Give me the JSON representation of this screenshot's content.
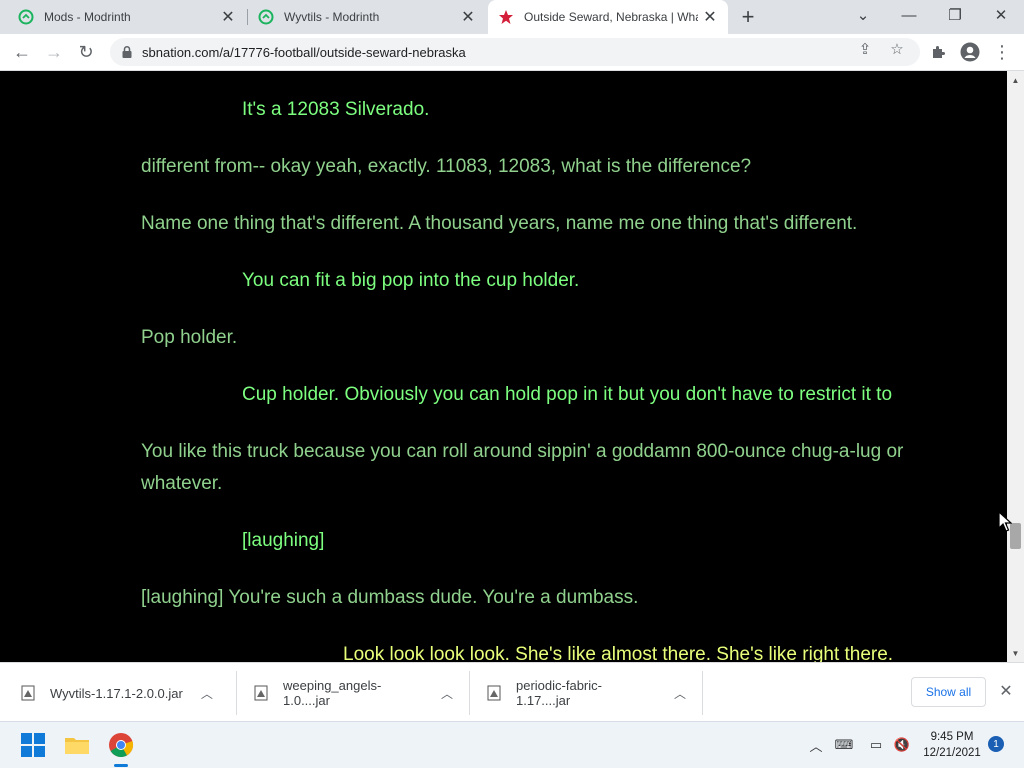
{
  "browser": {
    "tabs": [
      {
        "title": "Mods - Modrinth",
        "icon": "modrinth-icon",
        "active": false
      },
      {
        "title": "Wyvtils - Modrinth",
        "icon": "modrinth-icon",
        "active": false
      },
      {
        "title": "Outside Seward, Nebraska | Wha",
        "icon": "star-icon",
        "active": true
      }
    ],
    "url": "sbnation.com/a/17776-football/outside-seward-nebraska"
  },
  "transcript": [
    {
      "text": "It's a 12083 Silverado.",
      "speaker": "a"
    },
    {
      "text": "different from-- okay yeah, exactly. 11083, 12083, what is the difference?",
      "speaker": "b"
    },
    {
      "text": "Name one thing that's different. A thousand years, name me one thing that's different.",
      "speaker": "b"
    },
    {
      "text": "You can fit a big pop into the cup holder.",
      "speaker": "a"
    },
    {
      "text": "Pop holder.",
      "speaker": "b"
    },
    {
      "text": "Cup holder. Obviously you can hold pop in it but you don't have to restrict it to",
      "speaker": "a"
    },
    {
      "text": "You like this truck because you can roll around sippin' a goddamn 800-ounce chug-a-lug or",
      "speaker": "b"
    },
    {
      "text": "whatever.",
      "speaker": "b"
    },
    {
      "text": "[laughing]",
      "speaker": "a"
    },
    {
      "text": "[laughing] You're such a dumbass dude. You're a dumbass.",
      "speaker": "b"
    },
    {
      "text": "Look look look look. She's like almost there. She's like right there.",
      "speaker": "c"
    }
  ],
  "downloads": [
    {
      "name": "Wyvtils-1.17.1-2.0.0.jar"
    },
    {
      "name": "weeping_angels-1.0....jar"
    },
    {
      "name": "periodic-fabric-1.17....jar"
    }
  ],
  "show_all_label": "Show all",
  "taskbar": {
    "time": "9:45 PM",
    "date": "12/21/2021",
    "notification_count": "1"
  },
  "colors": {
    "speaker_a": "#7dff80",
    "speaker_b": "#8fd18d",
    "speaker_c": "#e8ff7a"
  }
}
